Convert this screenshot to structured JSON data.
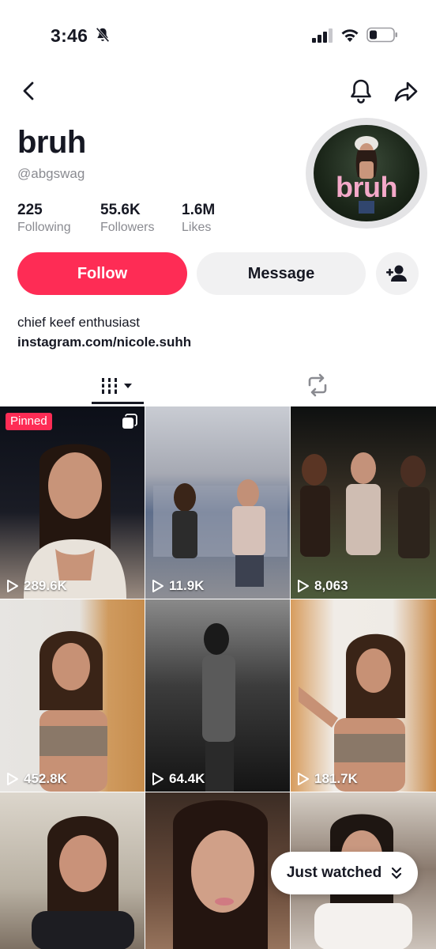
{
  "status_bar": {
    "time": "3:46"
  },
  "profile": {
    "name": "bruh",
    "handle": "@abgswag",
    "avatar_text": "bruh",
    "stats": [
      {
        "value": "225",
        "label": "Following"
      },
      {
        "value": "55.6K",
        "label": "Followers"
      },
      {
        "value": "1.6M",
        "label": "Likes"
      }
    ],
    "bio": "chief keef enthusiast",
    "link": "instagram.com/nicole.suhh"
  },
  "actions": {
    "follow_label": "Follow",
    "message_label": "Message"
  },
  "colors": {
    "accent": "#fe2c55",
    "secondary_button": "#f1f1f2",
    "muted_text": "#8a8b91"
  },
  "icons": [
    "bell-off-icon",
    "signal-icon",
    "wifi-icon",
    "battery-icon",
    "back-icon",
    "bell-icon",
    "share-icon",
    "add-friend-icon",
    "grid-icon",
    "repost-icon",
    "play-icon",
    "multi-image-icon",
    "chevron-double-down-icon"
  ],
  "videos": [
    {
      "views": "289.6K",
      "pinned_label": "Pinned"
    },
    {
      "views": "11.9K"
    },
    {
      "views": "8,063"
    },
    {
      "views": "452.8K"
    },
    {
      "views": "64.4K"
    },
    {
      "views": "181.7K"
    },
    {
      "views": ""
    },
    {
      "views": ""
    },
    {
      "views": ""
    }
  ],
  "overlay": {
    "just_watched_label": "Just watched"
  }
}
